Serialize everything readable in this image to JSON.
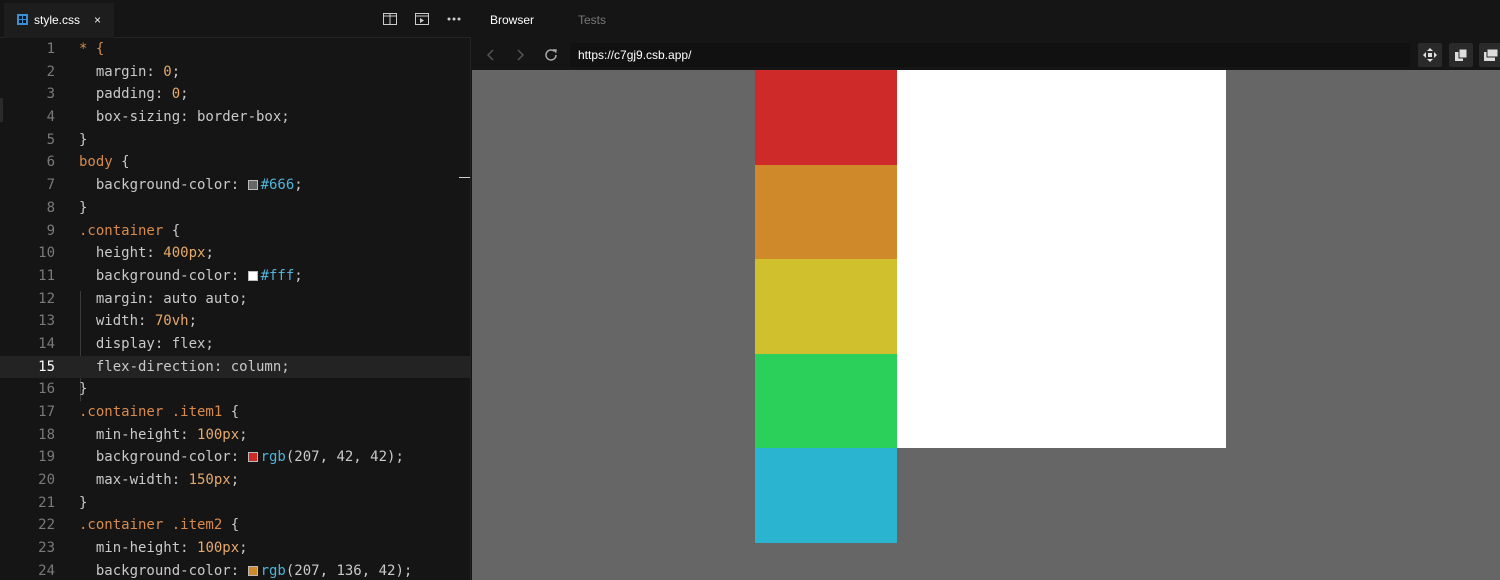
{
  "editor": {
    "tab": {
      "filename": "style.css",
      "close": "×"
    },
    "active_line": 15,
    "lines": [
      {
        "n": "1"
      },
      {
        "n": "2"
      },
      {
        "n": "3"
      },
      {
        "n": "4"
      },
      {
        "n": "5"
      },
      {
        "n": "6"
      },
      {
        "n": "7"
      },
      {
        "n": "8"
      },
      {
        "n": "9"
      },
      {
        "n": "10"
      },
      {
        "n": "11"
      },
      {
        "n": "12"
      },
      {
        "n": "13"
      },
      {
        "n": "14"
      },
      {
        "n": "15"
      },
      {
        "n": "16"
      },
      {
        "n": "17"
      },
      {
        "n": "18"
      },
      {
        "n": "19"
      },
      {
        "n": "20"
      },
      {
        "n": "21"
      },
      {
        "n": "22"
      },
      {
        "n": "23"
      },
      {
        "n": "24"
      }
    ],
    "code": {
      "l1_sel": "* {",
      "l2_prop": "margin: ",
      "l2_val": "0",
      "l2_end": ";",
      "l3_prop": "padding: ",
      "l3_val": "0",
      "l3_end": ";",
      "l4_text": "box-sizing: border-box;",
      "l5_text": "}",
      "l6_sel": "body",
      "l6_brace": " {",
      "l7_prop": "background-color: ",
      "l7_val": "#666",
      "l7_end": ";",
      "l7_swatch": "#666666",
      "l8_text": "}",
      "l9_sel": ".container",
      "l9_brace": " {",
      "l10_prop": "height: ",
      "l10_val": "400px",
      "l10_end": ";",
      "l11_prop": "background-color: ",
      "l11_val": "#fff",
      "l11_end": ";",
      "l11_swatch": "#ffffff",
      "l12_text": "margin: auto auto;",
      "l13_prop": "width: ",
      "l13_val": "70vh",
      "l13_end": ";",
      "l14_text": "display: flex;",
      "l15_text": "flex-direction: column;",
      "l16_text": "}",
      "l17_sel": ".container .item1",
      "l17_brace": " {",
      "l18_prop": "min-height: ",
      "l18_val": "100px",
      "l18_end": ";",
      "l19_prop": "background-color: ",
      "l19_fn": "rgb",
      "l19_args": "(207, 42, 42);",
      "l19_swatch": "#cf2a2a",
      "l20_prop": "max-width: ",
      "l20_val": "150px",
      "l20_end": ";",
      "l21_text": "}",
      "l22_sel": ".container .item2",
      "l22_brace": " {",
      "l23_prop": "min-height: ",
      "l23_val": "100px",
      "l23_end": ";",
      "l24_prop": "background-color: ",
      "l24_fn": "rgb",
      "l24_args": "(207, 136, 42);",
      "l24_swatch": "#cf882a"
    }
  },
  "browser": {
    "tabs": [
      "Browser",
      "Tests"
    ],
    "url": "https://c7gj9.csb.app/",
    "preview": {
      "page_bg": "#666666",
      "container_bg": "#ffffff",
      "items": [
        {
          "name": "item1",
          "color": "#cf2a2a"
        },
        {
          "name": "item2",
          "color": "#cf882a"
        },
        {
          "name": "item3",
          "color": "#d0c02d"
        },
        {
          "name": "item4",
          "color": "#2ad05a"
        },
        {
          "name": "item5",
          "color": "#2ab4d0"
        }
      ]
    }
  }
}
